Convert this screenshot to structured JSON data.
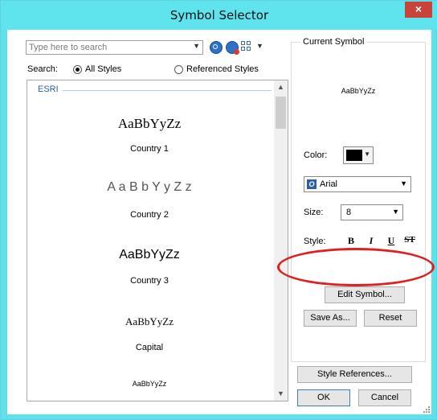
{
  "window": {
    "title": "Symbol Selector",
    "close_glyph": "×"
  },
  "search": {
    "placeholder": "Type here to search",
    "label": "Search:",
    "option_all": "All Styles",
    "option_referenced": "Referenced Styles",
    "selected": "All Styles"
  },
  "icons": {
    "search": "search-icon",
    "search_options": "search-options-icon",
    "view": "grid-view-icon"
  },
  "symbol_list": {
    "group": "ESRI",
    "items": [
      {
        "sample": "AaBbYyZz",
        "name": "Country 1"
      },
      {
        "sample": "A a B b Y y Z z",
        "name": "Country 2"
      },
      {
        "sample": "AaBbYyZz",
        "name": "Country 3"
      },
      {
        "sample": "AaBbYyZz",
        "name": "Capital"
      },
      {
        "sample": "AaBbYyZz",
        "name": ""
      }
    ]
  },
  "current_symbol": {
    "title": "Current Symbol",
    "preview": "AaBbYyZz",
    "color_label": "Color:",
    "color_value": "#000000",
    "font": "Arial",
    "size_label": "Size:",
    "size": "8",
    "style_label": "Style:",
    "style_buttons": [
      "B",
      "I",
      "U",
      "ST"
    ]
  },
  "buttons": {
    "edit_symbol": "Edit Symbol...",
    "save_as": "Save As...",
    "reset": "Reset",
    "style_references": "Style References...",
    "ok": "OK",
    "cancel": "Cancel"
  },
  "colors": {
    "titlebar": "#5fe4ee",
    "close": "#c9433a",
    "highlight_ellipse": "#e02020",
    "group_header": "#2d5fa8"
  }
}
